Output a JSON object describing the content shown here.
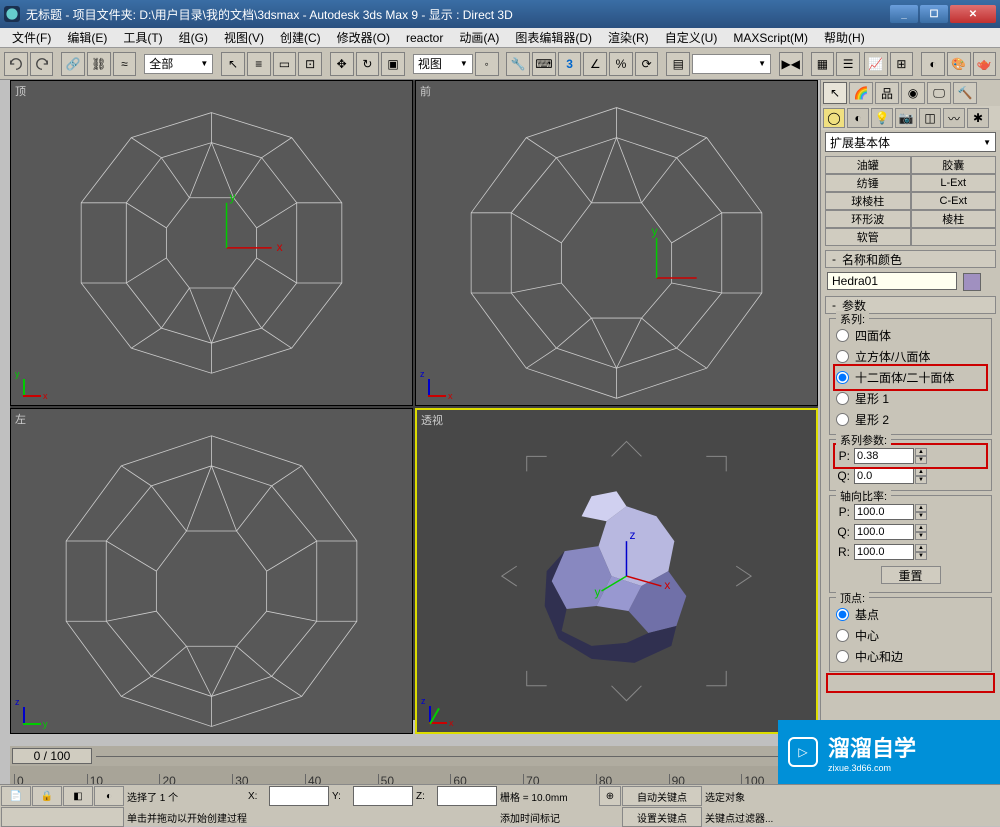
{
  "title": "无标题    - 项目文件夹: D:\\用户目录\\我的文档\\3dsmax    - Autodesk 3ds Max 9    - 显示 : Direct 3D",
  "menu": [
    "文件(F)",
    "编辑(E)",
    "工具(T)",
    "组(G)",
    "视图(V)",
    "创建(C)",
    "修改器(O)",
    "reactor",
    "动画(A)",
    "图表编辑器(D)",
    "渲染(R)",
    "自定义(U)",
    "MAXScript(M)",
    "帮助(H)"
  ],
  "toolbar": {
    "scope": "全部",
    "view": "视图"
  },
  "viewports": {
    "top": "顶",
    "front": "前",
    "left": "左",
    "persp": "透视"
  },
  "panel": {
    "category": "扩展基本体",
    "objtypes": [
      [
        "油罐",
        "胶囊"
      ],
      [
        "纺锤",
        "L-Ext"
      ],
      [
        "球棱柱",
        "C-Ext"
      ],
      [
        "环形波",
        "棱柱"
      ],
      [
        "软管",
        ""
      ]
    ],
    "r_name": "名称和颜色",
    "obj_name": "Hedra01",
    "r_params": "参数",
    "family_legend": "系列:",
    "family_opts": [
      "四面体",
      "立方体/八面体",
      "十二面体/二十面体",
      "星形 1",
      "星形 2"
    ],
    "family_selected": 2,
    "fp_legend": "系列参数:",
    "p_label": "P:",
    "p_val": "0.38",
    "q_label": "Q:",
    "q_val": "0.0",
    "axis_legend": "轴向比率:",
    "ap_label": "P:",
    "ap_val": "100.0",
    "aq_label": "Q:",
    "aq_val": "100.0",
    "ar_label": "R:",
    "ar_val": "100.0",
    "reset": "重置",
    "vertex_legend": "顶点:",
    "vertex_opts": [
      "基点",
      "中心",
      "中心和边"
    ],
    "vertex_selected": 0
  },
  "timeline": {
    "frame": "0 / 100",
    "marks": [
      "0",
      "10",
      "20",
      "30",
      "40",
      "50",
      "60",
      "70",
      "80",
      "90",
      "100"
    ]
  },
  "status": {
    "sel": "选择了 1 个",
    "x": "X:",
    "y": "Y:",
    "z": "Z:",
    "grid": "栅格 = 10.0mm",
    "autokey": "自动关键点",
    "selobj": "选定对象",
    "setkey": "设置关键点",
    "keyfilter": "关键点过滤器...",
    "hint": "单击并拖动以开始创建过程",
    "addmark": "添加时间标记"
  },
  "watermark": {
    "big": "溜溜自学",
    "small": "zixue.3d66.com"
  }
}
